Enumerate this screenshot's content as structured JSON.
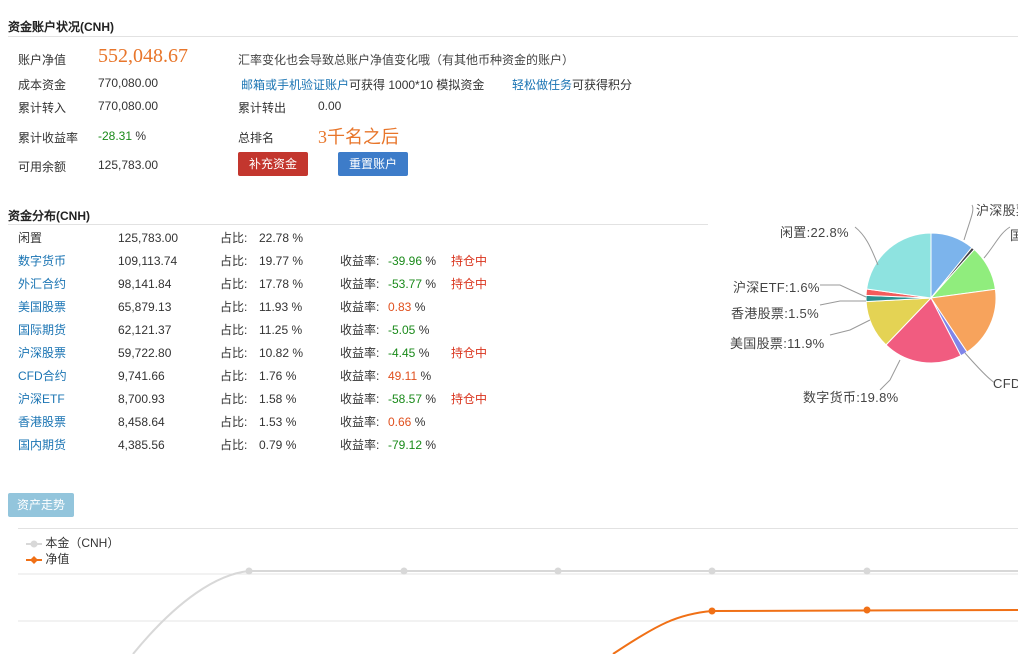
{
  "account": {
    "title": "资金账户状况(CNH)",
    "net_value_label": "账户净值",
    "net_value": "552,048.67",
    "fx_note": "汇率变化也会导致总账户净值变化哦（有其他币种资金的账户）",
    "cost_label": "成本资金",
    "cost_value": "770,080.00",
    "verify_link": "邮箱或手机验证账户",
    "verify_text": "可获得 1000*10 模拟资金",
    "task_link": "轻松做任务",
    "task_text": "可获得积分",
    "in_label": "累计转入",
    "in_value": "770,080.00",
    "out_label": "累计转出",
    "out_value": "0.00",
    "return_label": "累计收益率",
    "return_value": "-28.31",
    "return_unit": "%",
    "rank_label": "总排名",
    "rank_value": "3千名之后",
    "avail_label": "可用余额",
    "avail_value": "125,783.00",
    "topup_button": "补充资金",
    "reset_button": "重置账户"
  },
  "distribution": {
    "title": "资金分布(CNH)",
    "share_label": "占比:",
    "yield_label": "收益率:",
    "rows": [
      {
        "name": "闲置",
        "amount": "125,783.00",
        "share": "22.78 %",
        "yield": "",
        "hold": "",
        "link": false
      },
      {
        "name": "数字货币",
        "amount": "109,113.74",
        "share": "19.77 %",
        "yield": "-39.96",
        "yield_unit": "%",
        "hold": "持仓中",
        "link": true,
        "sign": "neg"
      },
      {
        "name": "外汇合约",
        "amount": "98,141.84",
        "share": "17.78 %",
        "yield": "-53.77",
        "yield_unit": "%",
        "hold": "持仓中",
        "link": true,
        "sign": "neg"
      },
      {
        "name": "美国股票",
        "amount": "65,879.13",
        "share": "11.93 %",
        "yield": "0.83",
        "yield_unit": "%",
        "hold": "",
        "link": true,
        "sign": "pos"
      },
      {
        "name": "国际期货",
        "amount": "62,121.37",
        "share": "11.25 %",
        "yield": "-5.05",
        "yield_unit": "%",
        "hold": "",
        "link": true,
        "sign": "neg"
      },
      {
        "name": "沪深股票",
        "amount": "59,722.80",
        "share": "10.82 %",
        "yield": "-4.45",
        "yield_unit": "%",
        "hold": "持仓中",
        "link": true,
        "sign": "neg"
      },
      {
        "name": "CFD合约",
        "amount": "9,741.66",
        "share": "1.76 %",
        "yield": "49.11",
        "yield_unit": "%",
        "hold": "",
        "link": true,
        "sign": "pos"
      },
      {
        "name": "沪深ETF",
        "amount": "8,700.93",
        "share": "1.58 %",
        "yield": "-58.57",
        "yield_unit": "%",
        "hold": "持仓中",
        "link": true,
        "sign": "neg"
      },
      {
        "name": "香港股票",
        "amount": "8,458.64",
        "share": "1.53 %",
        "yield": "0.66",
        "yield_unit": "%",
        "hold": "",
        "link": true,
        "sign": "pos"
      },
      {
        "name": "国内期货",
        "amount": "4,385.56",
        "share": "0.79 %",
        "yield": "-79.12",
        "yield_unit": "%",
        "hold": "",
        "link": true,
        "sign": "neg"
      }
    ]
  },
  "pie": {
    "labels": {
      "idle": "闲置:22.8%",
      "hs_stock": "沪深股票",
      "intl": "国",
      "hs_etf": "沪深ETF:1.6%",
      "hk": "香港股票:1.5%",
      "us": "美国股票:11.9%",
      "crypto": "数字货币:19.8%",
      "cfd": "CFD"
    },
    "colors": {
      "idle": "#8ee3e0",
      "hs_stock": "#7cb4ec",
      "domestic": "#434348",
      "intl": "#90ed7d",
      "forex": "#f7a35c",
      "cfd": "#8085e9",
      "crypto": "#f15c80",
      "us": "#e4d354",
      "hk": "#2b908f",
      "hs_etf": "#f45b5b"
    }
  },
  "trend": {
    "button": "资产走势",
    "legend_principal": "本金（CNH）",
    "legend_net": "净值",
    "principal_color": "#d8d8d8",
    "net_color": "#f07016"
  }
}
